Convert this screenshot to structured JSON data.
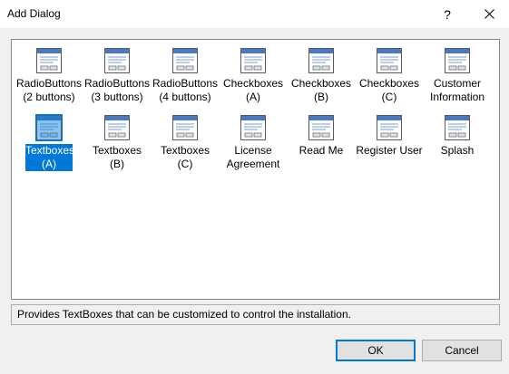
{
  "window": {
    "title": "Add Dialog",
    "help_label": "?"
  },
  "items": [
    {
      "label": "RadioButtons\n(2 buttons)",
      "name": "item-radiobuttons-2"
    },
    {
      "label": "RadioButtons\n(3 buttons)",
      "name": "item-radiobuttons-3"
    },
    {
      "label": "RadioButtons\n(4 buttons)",
      "name": "item-radiobuttons-4"
    },
    {
      "label": "Checkboxes\n(A)",
      "name": "item-checkboxes-a"
    },
    {
      "label": "Checkboxes\n(B)",
      "name": "item-checkboxes-b"
    },
    {
      "label": "Checkboxes\n(C)",
      "name": "item-checkboxes-c"
    },
    {
      "label": "Customer\nInformation",
      "name": "item-customer-information"
    },
    {
      "label": "Textboxes\n(A)",
      "name": "item-textboxes-a",
      "selected": true
    },
    {
      "label": "Textboxes\n(B)",
      "name": "item-textboxes-b"
    },
    {
      "label": "Textboxes\n(C)",
      "name": "item-textboxes-c"
    },
    {
      "label": "License\nAgreement",
      "name": "item-license-agreement"
    },
    {
      "label": "Read Me",
      "name": "item-read-me"
    },
    {
      "label": "Register User",
      "name": "item-register-user"
    },
    {
      "label": "Splash",
      "name": "item-splash"
    }
  ],
  "description": "Provides TextBoxes that can be customized to control the installation.",
  "buttons": {
    "ok": "OK",
    "cancel": "Cancel"
  },
  "colors": {
    "selection": "#0078d7",
    "icon_header": "#4a78c2"
  },
  "icons": {
    "item": "dialog-icon",
    "close": "close-icon"
  }
}
